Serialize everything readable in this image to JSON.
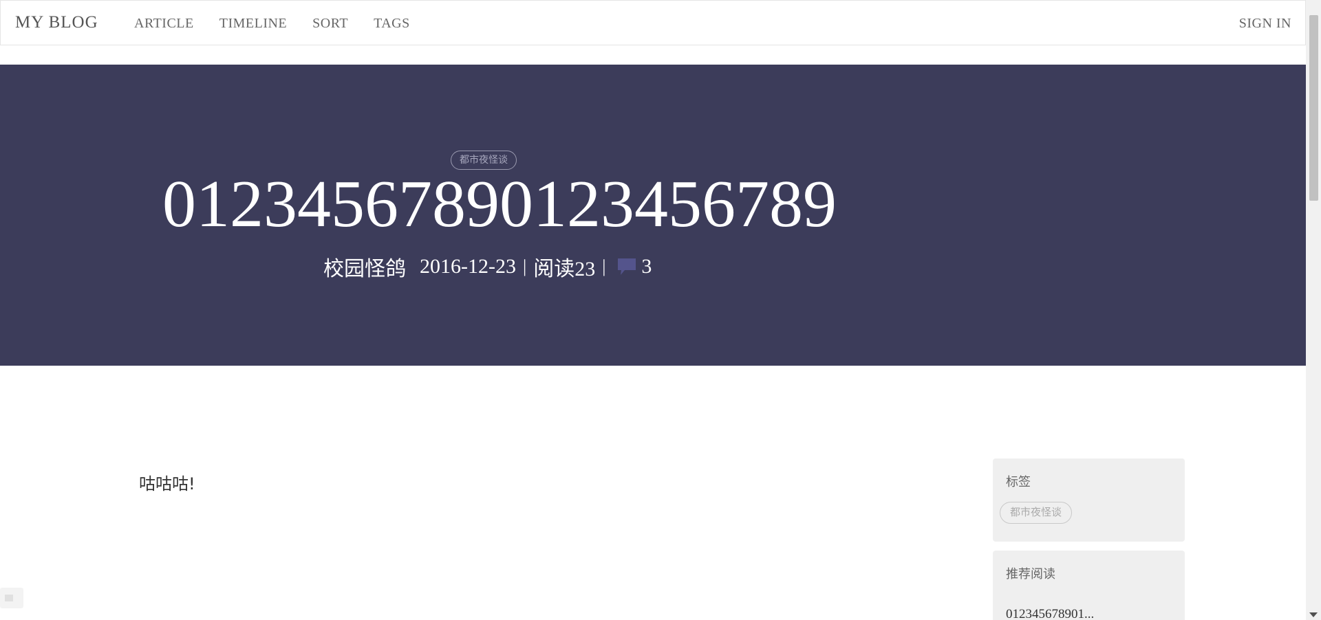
{
  "navbar": {
    "brand": "MY BLOG",
    "links": [
      "ARTICLE",
      "TIMELINE",
      "SORT",
      "TAGS"
    ],
    "signin": "SIGN IN"
  },
  "hero": {
    "tag": "都市夜怪谈",
    "title": "01234567890123456789",
    "author": "校园怪鸽",
    "date": "2016-12-23",
    "reads": "阅读23",
    "comments": "3",
    "background_color": "#3c3c5a",
    "comment_icon_color": "#54548c"
  },
  "article": {
    "text": "咕咕咕!"
  },
  "sidebar": {
    "tags_widget": {
      "title": "标签",
      "tags": [
        "都市夜怪谈"
      ]
    },
    "recommend_widget": {
      "title": "推荐阅读",
      "items": [
        "012345678901..."
      ]
    }
  }
}
